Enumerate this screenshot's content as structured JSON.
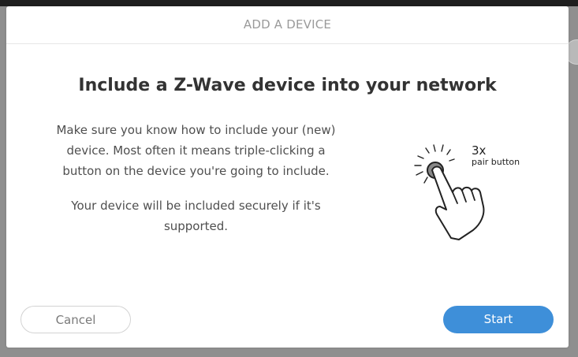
{
  "dialog": {
    "title": "ADD A DEVICE",
    "headline": "Include a Z-Wave device into your network",
    "instructions": [
      "Make sure you know how to include your (new) device. Most often it means triple-clicking a button on the device you're going to include.",
      "Your device will be included securely if it's supported."
    ],
    "illustration": {
      "icon": "hand-press-button-icon",
      "count_label": "3x",
      "caption": "pair button"
    },
    "buttons": {
      "cancel": "Cancel",
      "start": "Start"
    }
  },
  "colors": {
    "accent": "#3e8fd9",
    "backdrop": "#8f8f8f"
  }
}
